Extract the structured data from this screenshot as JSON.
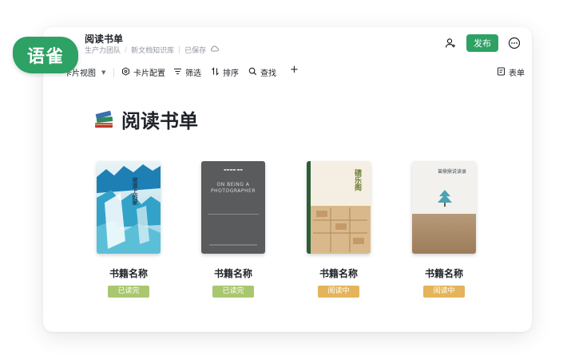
{
  "logo": {
    "text": "语雀"
  },
  "header": {
    "title": "阅读书单",
    "breadcrumb": [
      "生产力团队",
      "新文档知识库"
    ],
    "save_status": "已保存",
    "publish_label": "发布"
  },
  "toolbar": {
    "view_label": "卡片视图",
    "card_config_label": "卡片配置",
    "filter_label": "筛选",
    "sort_label": "排序",
    "search_label": "查找",
    "add_label": "+",
    "form_label": "表单"
  },
  "page": {
    "heading": "阅读书单"
  },
  "cards": [
    {
      "name": "书籍名称",
      "status": "已读完",
      "status_color": "#a9c76e",
      "cover_text": "坡道上的家"
    },
    {
      "name": "书籍名称",
      "status": "已读完",
      "status_color": "#a9c76e",
      "cover_text": "ON BEING A PHOTOGRAPHER"
    },
    {
      "name": "书籍名称",
      "status": "阅读中",
      "status_color": "#e3b45a",
      "cover_text": "碛乐阁"
    },
    {
      "name": "书籍名称",
      "status": "阅读中",
      "status_color": "#e3b45a",
      "cover_text": "曾鼎鼎说读录"
    }
  ],
  "colors": {
    "accent": "#2ea165"
  },
  "icons": [
    "add-member-icon",
    "more-icon",
    "card-config-icon",
    "filter-icon",
    "sort-icon",
    "search-icon",
    "form-icon",
    "cloud-icon",
    "books-icon"
  ]
}
